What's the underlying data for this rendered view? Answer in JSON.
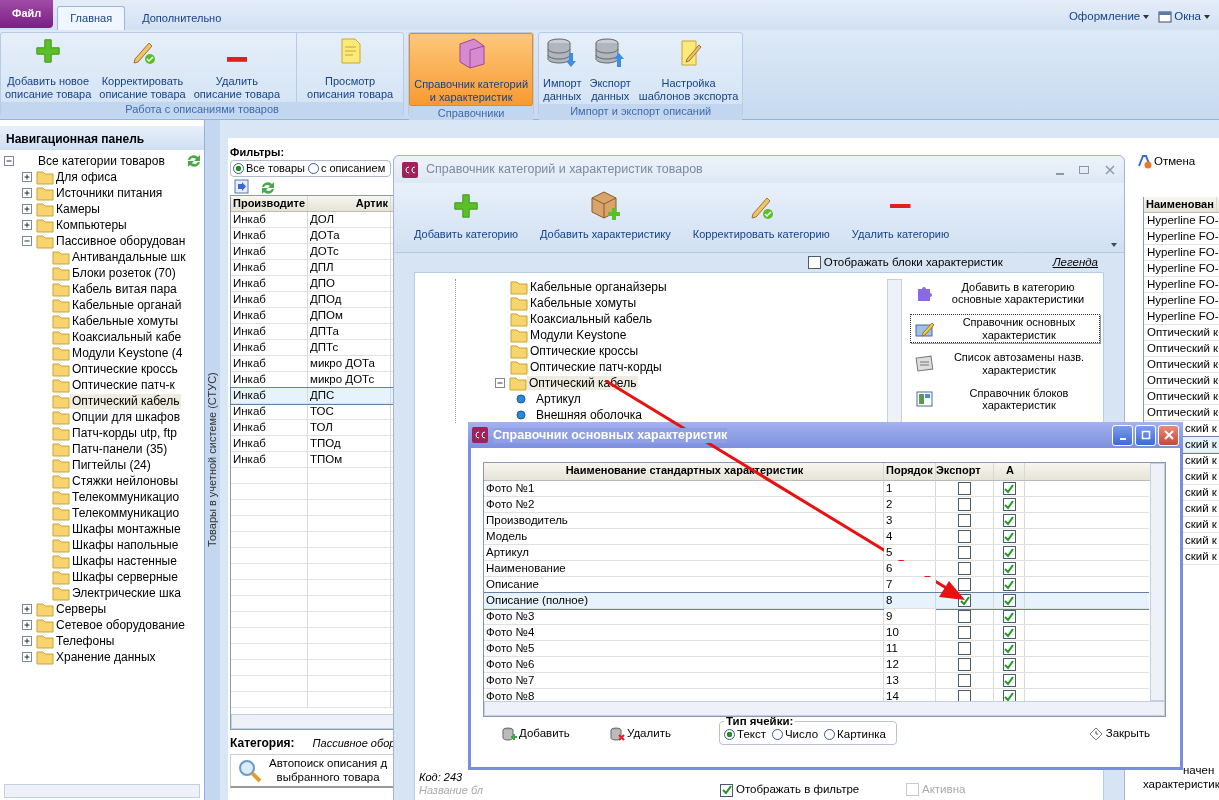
{
  "menu_tabs": [
    {
      "label": "Файл",
      "kind": "file",
      "selected": false
    },
    {
      "label": "Главная",
      "kind": "tab",
      "selected": true
    },
    {
      "label": "Дополнительно",
      "kind": "tab",
      "selected": false
    }
  ],
  "menu_right": [
    {
      "label": "Оформление",
      "kind": "plain"
    },
    {
      "label": "Окна",
      "kind": "window"
    }
  ],
  "ribbon_groups": [
    {
      "label": "Работа с описаниями товаров",
      "buttons": [
        {
          "lines": [
            "Добавить новое",
            "описание товара"
          ],
          "kind": "add",
          "selected": false
        },
        {
          "lines": [
            "Корректировать",
            "описание товара"
          ],
          "kind": "edit",
          "selected": false
        },
        {
          "lines": [
            "Удалить",
            "описание товара"
          ],
          "kind": "remove",
          "selected": false
        },
        {
          "lines": [
            "Просмотр",
            "описания товара"
          ],
          "kind": "view",
          "selected": false
        }
      ]
    },
    {
      "label": "Справочники",
      "buttons": [
        {
          "lines": [
            "Справочник категорий",
            "и характеристик"
          ],
          "kind": "reference",
          "selected": true
        }
      ]
    },
    {
      "label": "Импорт и экспорт описаний",
      "buttons": [
        {
          "lines": [
            "Импорт",
            "данных"
          ],
          "kind": "import",
          "selected": false
        },
        {
          "lines": [
            "Экспорт",
            "данных"
          ],
          "kind": "export",
          "selected": false
        },
        {
          "lines": [
            "Настройка",
            "шаблонов экспорта"
          ],
          "kind": "template",
          "selected": false
        }
      ]
    }
  ],
  "nav": {
    "title": "Навигационная панель",
    "tree": [
      {
        "label": "Все категории товаров",
        "expanded": true,
        "children": [
          {
            "label": "Для офиса",
            "expanded": false,
            "selected": false
          },
          {
            "label": "Источники питания",
            "expanded": false,
            "selected": false
          },
          {
            "label": "Камеры",
            "expanded": false,
            "selected": false
          },
          {
            "label": "Компьютеры",
            "expanded": false,
            "selected": false
          },
          {
            "label": "Пассивное оборудован",
            "expanded": true,
            "selected": false,
            "children": [
              {
                "label": "Антивандальные шк",
                "selected": false
              },
              {
                "label": "Блоки розеток (70)",
                "selected": false
              },
              {
                "label": "Кабель витая пара",
                "selected": false
              },
              {
                "label": "Кабельные органай",
                "selected": false
              },
              {
                "label": "Кабельные хомуты",
                "selected": false
              },
              {
                "label": "Коаксиальный кабе",
                "selected": false
              },
              {
                "label": "Модули Keystone (4",
                "selected": false
              },
              {
                "label": "Оптические кроссь",
                "selected": false
              },
              {
                "label": "Оптические патч-к",
                "selected": false
              },
              {
                "label": "Оптический кабель",
                "selected": true
              },
              {
                "label": "Опции для шкафов",
                "selected": false
              },
              {
                "label": "Патч-корды utp, ftp",
                "selected": false
              },
              {
                "label": "Патч-панели (35)",
                "selected": false
              },
              {
                "label": "Пигтейлы (24)",
                "selected": false
              },
              {
                "label": "Стяжки нейлоновы",
                "selected": false
              },
              {
                "label": "Телекоммуникацио",
                "selected": false
              },
              {
                "label": "Телекоммуникацио",
                "selected": false
              },
              {
                "label": "Шкафы монтажные",
                "selected": false
              },
              {
                "label": "Шкафы напольные",
                "selected": false
              },
              {
                "label": "Шкафы настенные",
                "selected": false
              },
              {
                "label": "Шкафы серверные",
                "selected": false
              },
              {
                "label": "Электрические шка",
                "selected": false
              }
            ]
          },
          {
            "label": "Серверы",
            "expanded": false,
            "selected": false
          },
          {
            "label": "Сетевое оборудование",
            "expanded": false,
            "selected": false
          },
          {
            "label": "Телефоны",
            "expanded": false,
            "selected": false
          },
          {
            "label": "Хранение данных",
            "expanded": false,
            "selected": false
          }
        ]
      }
    ]
  },
  "side_caption": "Товары в учетной системе (СТУС)",
  "main": {
    "filters_label": "Фильтры:",
    "filters": [
      {
        "label": "Все товары",
        "selected": true
      },
      {
        "label": "с описанием",
        "selected": false
      }
    ],
    "columns": [
      "Производите",
      "Артик"
    ],
    "rows": [
      {
        "cells": [
          "Инкаб",
          "ДОЛ"
        ],
        "selected": false
      },
      {
        "cells": [
          "Инкаб",
          "ДОТа"
        ],
        "selected": false
      },
      {
        "cells": [
          "Инкаб",
          "ДОТс"
        ],
        "selected": false
      },
      {
        "cells": [
          "Инкаб",
          "ДПЛ"
        ],
        "selected": false
      },
      {
        "cells": [
          "Инкаб",
          "ДПО"
        ],
        "selected": false
      },
      {
        "cells": [
          "Инкаб",
          "ДПОд"
        ],
        "selected": false
      },
      {
        "cells": [
          "Инкаб",
          "ДПОм"
        ],
        "selected": false
      },
      {
        "cells": [
          "Инкаб",
          "ДПТа"
        ],
        "selected": false
      },
      {
        "cells": [
          "Инкаб",
          "ДПТс"
        ],
        "selected": false
      },
      {
        "cells": [
          "Инкаб",
          "микро ДОТа"
        ],
        "selected": false
      },
      {
        "cells": [
          "Инкаб",
          "микро ДОТс"
        ],
        "selected": false
      },
      {
        "cells": [
          "Инкаб",
          "ДПС"
        ],
        "selected": true
      },
      {
        "cells": [
          "Инкаб",
          "ТОС"
        ],
        "selected": false
      },
      {
        "cells": [
          "Инкаб",
          "ТОЛ"
        ],
        "selected": false
      },
      {
        "cells": [
          "Инкаб",
          "ТПОд"
        ],
        "selected": false
      },
      {
        "cells": [
          "Инкаб",
          "ТПОм"
        ],
        "selected": false
      }
    ],
    "category_label": "Категория:",
    "category_value": "Пассивное обор",
    "autosearch_lines": [
      "Автопоиск описания д",
      "выбранного товара"
    ]
  },
  "right": {
    "cancel": "Отмена",
    "column": "Наименован",
    "rows": [
      {
        "text": "Hyperline FO-",
        "covered": false,
        "selected": false
      },
      {
        "text": "Hyperline FO-",
        "covered": false,
        "selected": false
      },
      {
        "text": "Hyperline FO-",
        "covered": false,
        "selected": false
      },
      {
        "text": "Hyperline FO-",
        "covered": false,
        "selected": false
      },
      {
        "text": "Hyperline FO-",
        "covered": false,
        "selected": false
      },
      {
        "text": "Hyperline FO-",
        "covered": false,
        "selected": false
      },
      {
        "text": "Hyperline FO-",
        "covered": false,
        "selected": false
      },
      {
        "text": "Оптический к",
        "covered": false,
        "selected": false
      },
      {
        "text": "Оптический к",
        "covered": false,
        "selected": false
      },
      {
        "text": "Оптический к",
        "covered": false,
        "selected": false
      },
      {
        "text": "Оптический к",
        "covered": false,
        "selected": false
      },
      {
        "text": "Оптический к",
        "covered": false,
        "selected": false
      },
      {
        "text": "Оптический к",
        "covered": false,
        "selected": false
      },
      {
        "text": "ский к",
        "covered": true,
        "selected": false
      },
      {
        "text": "ский к",
        "covered": true,
        "selected": true
      },
      {
        "text": "ский к",
        "covered": true,
        "selected": false
      },
      {
        "text": "ский к",
        "covered": true,
        "selected": false
      },
      {
        "text": "ский к",
        "covered": true,
        "selected": false
      },
      {
        "text": "ский к",
        "covered": true,
        "selected": false
      },
      {
        "text": "ский к",
        "covered": true,
        "selected": false
      },
      {
        "text": "ский к",
        "covered": true,
        "selected": false
      },
      {
        "text": "ский к",
        "covered": true,
        "selected": false
      }
    ],
    "bottom_lines": [
      "начен",
      "характеристик"
    ]
  },
  "categories_dialog": {
    "title": "Справочник категорий и характеристик товаров",
    "toolbar": [
      {
        "label": "Добавить категорию",
        "kind": "add"
      },
      {
        "label": "Добавить характеристику",
        "kind": "add_characteristic"
      },
      {
        "label": "Корректировать категорию",
        "kind": "edit"
      },
      {
        "label": "Удалить категорию",
        "kind": "remove"
      }
    ],
    "show_blocks": {
      "label": "Отображать блоки характеристик",
      "checked": false
    },
    "legend": "Легенда",
    "tree": [
      {
        "label": "Кабельные органайзеры",
        "selected": false
      },
      {
        "label": "Кабельные хомуты",
        "selected": false
      },
      {
        "label": "Коаксиальный кабель",
        "selected": false
      },
      {
        "label": "Модули Keystone",
        "selected": false
      },
      {
        "label": "Оптические кроссы",
        "selected": false
      },
      {
        "label": "Оптические патч-корды",
        "selected": false
      },
      {
        "label": "Оптический кабель",
        "expanded": true,
        "selected": true,
        "children": [
          {
            "label": "Артикул"
          },
          {
            "label": "Внешняя оболочка"
          }
        ]
      }
    ],
    "actions": [
      {
        "lines": [
          "Добавить в категорию",
          "основные характеристики"
        ],
        "kind": "add_basic",
        "focused": false
      },
      {
        "lines": [
          "Справочник основных",
          "характеристик"
        ],
        "kind": "basic_reference",
        "focused": true
      },
      {
        "lines": [
          "Список автозамены назв.",
          "характеристик"
        ],
        "kind": "autoreplace",
        "focused": false
      },
      {
        "lines": [
          "Справочник блоков",
          "характеристик"
        ],
        "kind": "blocks",
        "focused": false
      }
    ],
    "code": "Код: 243",
    "name_field": {
      "placeholder": "Название бл"
    },
    "show_in_filter": {
      "label": "Отображать в фильтре",
      "checked": true
    },
    "active": {
      "label": "Активна",
      "checked": false,
      "disabled": true
    }
  },
  "chars_dialog": {
    "title": "Справочник основных характеристик",
    "columns": [
      "Наименование стандартных характеристик",
      "Порядок",
      "Экспорт",
      "А"
    ],
    "rows": [
      {
        "name": "Фото №1",
        "order": "1",
        "export": false,
        "a": true,
        "selected": false
      },
      {
        "name": "Фото №2",
        "order": "2",
        "export": false,
        "a": true,
        "selected": false
      },
      {
        "name": "Производитель",
        "order": "3",
        "export": false,
        "a": true,
        "selected": false
      },
      {
        "name": "Модель",
        "order": "4",
        "export": false,
        "a": true,
        "selected": false
      },
      {
        "name": "Артикул",
        "order": "5",
        "export": false,
        "a": true,
        "selected": false
      },
      {
        "name": "Наименование",
        "order": "6",
        "export": false,
        "a": true,
        "selected": false
      },
      {
        "name": "Описание",
        "order": "7",
        "export": false,
        "a": true,
        "selected": false
      },
      {
        "name": "Описание (полное)",
        "order": "8",
        "export": true,
        "a": true,
        "selected": true
      },
      {
        "name": "Фото №3",
        "order": "9",
        "export": false,
        "a": true,
        "selected": false
      },
      {
        "name": "Фото №4",
        "order": "10",
        "export": false,
        "a": true,
        "selected": false
      },
      {
        "name": "Фото №5",
        "order": "11",
        "export": false,
        "a": true,
        "selected": false
      },
      {
        "name": "Фото №6",
        "order": "12",
        "export": false,
        "a": true,
        "selected": false
      },
      {
        "name": "Фото №7",
        "order": "13",
        "export": false,
        "a": true,
        "selected": false
      },
      {
        "name": "Фото №8",
        "order": "14",
        "export": false,
        "a": true,
        "selected": false
      }
    ],
    "add": "Добавить",
    "delete": "Удалить",
    "cell_type": {
      "label": "Тип ячейки:",
      "options": [
        {
          "label": "Текст",
          "selected": true
        },
        {
          "label": "Число",
          "selected": false
        },
        {
          "label": "Картинка",
          "selected": false
        }
      ]
    },
    "close": "Закрыть"
  }
}
